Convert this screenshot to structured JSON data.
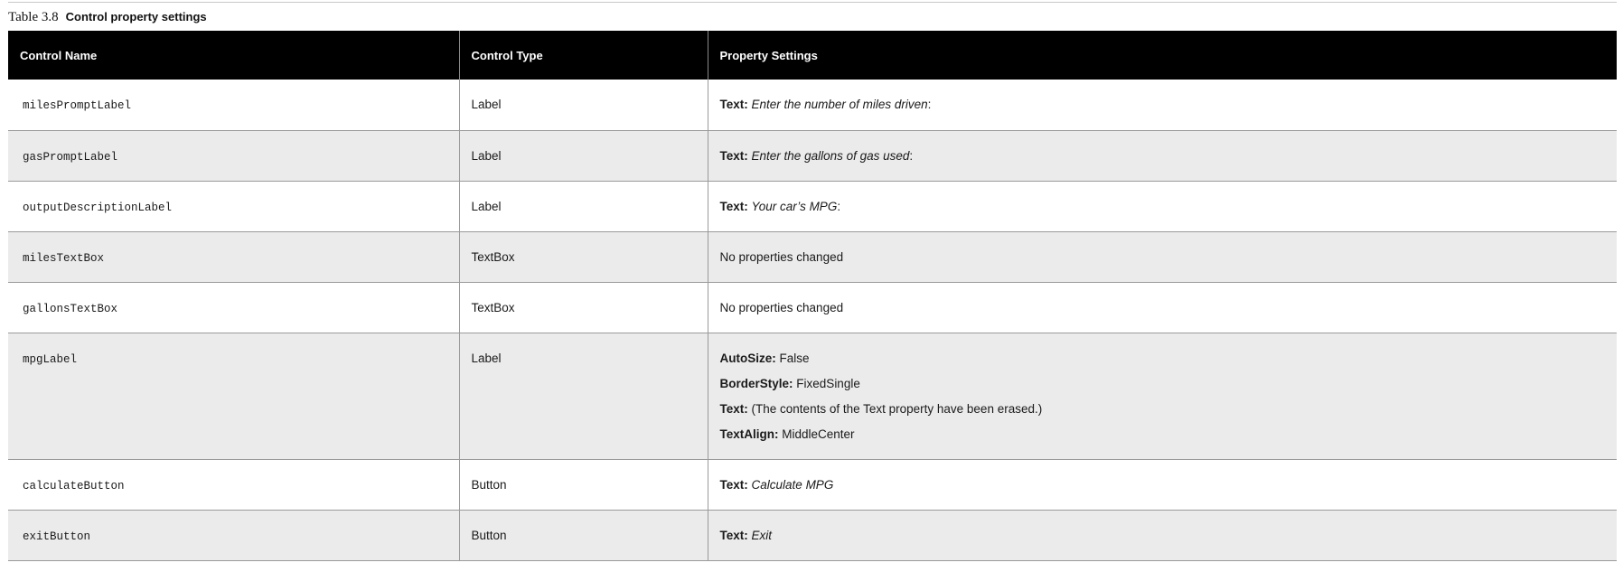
{
  "caption": {
    "number": "Table 3.8",
    "title": "Control property settings"
  },
  "columns": [
    "Control Name",
    "Control Type",
    "Property Settings"
  ],
  "rows": [
    {
      "name": "milesPromptLabel",
      "type": "Label",
      "settings": [
        {
          "key": "Text:",
          "value": "Enter the number of miles driven",
          "suffix": ":"
        }
      ]
    },
    {
      "name": "gasPromptLabel",
      "type": "Label",
      "settings": [
        {
          "key": "Text:",
          "value": "Enter the gallons of gas used",
          "suffix": ":"
        }
      ]
    },
    {
      "name": "outputDescriptionLabel",
      "type": "Label",
      "settings": [
        {
          "key": "Text:",
          "value": "Your car’s MPG",
          "suffix": ":"
        }
      ]
    },
    {
      "name": "milesTextBox",
      "type": "TextBox",
      "plain": "No properties changed"
    },
    {
      "name": "gallonsTextBox",
      "type": "TextBox",
      "plain": "No properties changed"
    },
    {
      "name": "mpgLabel",
      "type": "Label",
      "settings": [
        {
          "key": "AutoSize:",
          "value": "False"
        },
        {
          "key": "BorderStyle:",
          "value": "FixedSingle"
        },
        {
          "key": "Text:",
          "value": "(The contents of the Text property have been erased.)"
        },
        {
          "key": "TextAlign:",
          "value": "MiddleCenter"
        }
      ]
    },
    {
      "name": "calculateButton",
      "type": "Button",
      "settings": [
        {
          "key": "Text:",
          "value": "Calculate MPG"
        }
      ]
    },
    {
      "name": "exitButton",
      "type": "Button",
      "settings": [
        {
          "key": "Text:",
          "value": "Exit"
        }
      ]
    }
  ]
}
